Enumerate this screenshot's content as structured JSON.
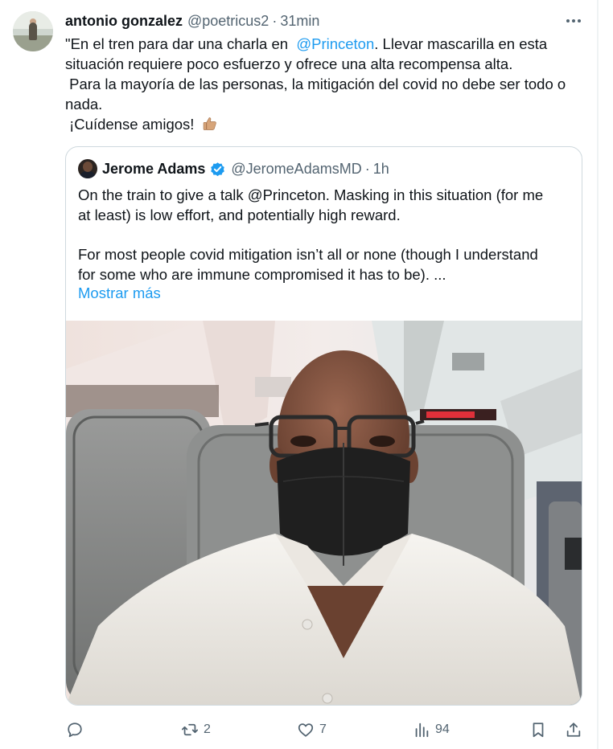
{
  "tweet": {
    "author_name": "antonio gonzalez",
    "author_handle": "@poetricus2",
    "separator": "·",
    "time": "31min",
    "text": {
      "line1_pre": "\"En el tren para dar una charla en  ",
      "line1_mention": "@Princeton",
      "line1_post": ". Llevar mascarilla en esta",
      "line2": "situación requiere poco esfuerzo y ofrece una alta recompensa alta.",
      "line3": " Para la mayoría de las personas, la mitigación del covid no debe ser todo o",
      "line4": "nada.",
      "line5": " ¡Cuídense amigos! "
    },
    "thumb_emoji": "thumbs-up-icon"
  },
  "quote": {
    "author_name": "Jerome Adams",
    "author_handle": "@JeromeAdamsMD",
    "separator": "·",
    "time": "1h",
    "text": {
      "line1": "On the train to give a talk @Princeton. Masking in this situation (for me",
      "line2": "at least) is low effort, and potentially high reward.",
      "line3": "For most people covid mitigation isn’t all or none (though I understand",
      "line4": "for some who are immune compromised it has to be). ..."
    },
    "show_more": "Mostrar más"
  },
  "actions": {
    "reply_count": "",
    "retweet_count": "2",
    "like_count": "7",
    "views_count": "94"
  },
  "colors": {
    "accent": "#1d9bf0",
    "secondary_text": "#536471",
    "border": "#cfd9de",
    "primary_text": "#0f1419"
  }
}
